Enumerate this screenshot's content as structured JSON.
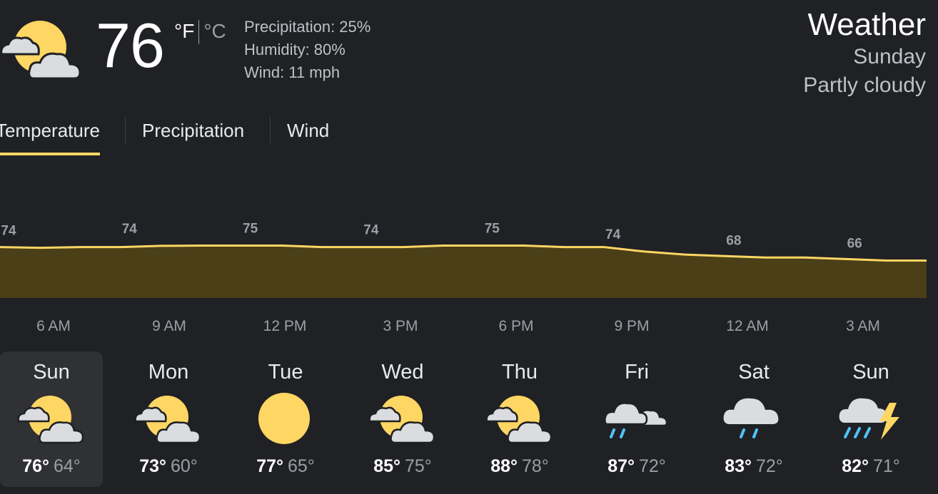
{
  "current": {
    "icon": "partly-cloudy-icon",
    "temperature": "76",
    "unit_f": "°F",
    "unit_c": "°C",
    "precipitation": "Precipitation: 25%",
    "humidity": "Humidity: 80%",
    "wind": "Wind: 11 mph"
  },
  "header": {
    "title": "Weather",
    "day": "Sunday",
    "condition": "Partly cloudy"
  },
  "tabs": [
    {
      "label": "Temperature",
      "active": true
    },
    {
      "label": "Precipitation",
      "active": false
    },
    {
      "label": "Wind",
      "active": false
    }
  ],
  "colors": {
    "accent": "#fdd663",
    "area_fill": "#4a3f17",
    "background": "#202124",
    "selected_card": "#303134"
  },
  "chart_data": {
    "type": "area",
    "x": [
      "5 AM",
      "6 AM",
      "7 AM",
      "8 AM",
      "9 AM",
      "10 AM",
      "11 AM",
      "12 PM",
      "1 PM",
      "2 PM",
      "3 PM",
      "4 PM",
      "5 PM",
      "6 PM",
      "7 PM",
      "8 PM",
      "9 PM",
      "10 PM",
      "11 PM",
      "12 AM",
      "1 AM",
      "2 AM",
      "3 AM",
      "4 AM"
    ],
    "values": [
      74,
      73.5,
      74,
      74,
      74.8,
      75,
      75,
      75,
      74,
      74,
      74,
      75,
      75,
      75,
      74,
      74,
      71,
      69,
      68,
      67,
      67,
      66,
      65,
      65
    ],
    "labels": [
      {
        "text": "74"
      },
      {
        "text": "74"
      },
      {
        "text": "75"
      },
      {
        "text": "74"
      },
      {
        "text": "75"
      },
      {
        "text": "74"
      },
      {
        "text": "68"
      },
      {
        "text": "66"
      }
    ],
    "tick_labels": [
      "6 AM",
      "9 AM",
      "12 PM",
      "3 PM",
      "6 PM",
      "9 PM",
      "12 AM",
      "3 AM"
    ],
    "ylim": [
      40,
      80
    ]
  },
  "forecast": [
    {
      "day": "Sun",
      "icon": "partly-cloudy-icon",
      "high": "76°",
      "low": "64°",
      "selected": true
    },
    {
      "day": "Mon",
      "icon": "partly-cloudy-icon",
      "high": "73°",
      "low": "60°",
      "selected": false
    },
    {
      "day": "Tue",
      "icon": "sunny-icon",
      "high": "77°",
      "low": "65°",
      "selected": false
    },
    {
      "day": "Wed",
      "icon": "partly-cloudy-icon",
      "high": "85°",
      "low": "75°",
      "selected": false
    },
    {
      "day": "Thu",
      "icon": "partly-cloudy-icon",
      "high": "88°",
      "low": "78°",
      "selected": false
    },
    {
      "day": "Fri",
      "icon": "rain-clouds-icon",
      "high": "87°",
      "low": "72°",
      "selected": false
    },
    {
      "day": "Sat",
      "icon": "rain-icon",
      "high": "83°",
      "low": "72°",
      "selected": false
    },
    {
      "day": "Sun",
      "icon": "thunderstorm-icon",
      "high": "82°",
      "low": "71°",
      "selected": false
    }
  ]
}
